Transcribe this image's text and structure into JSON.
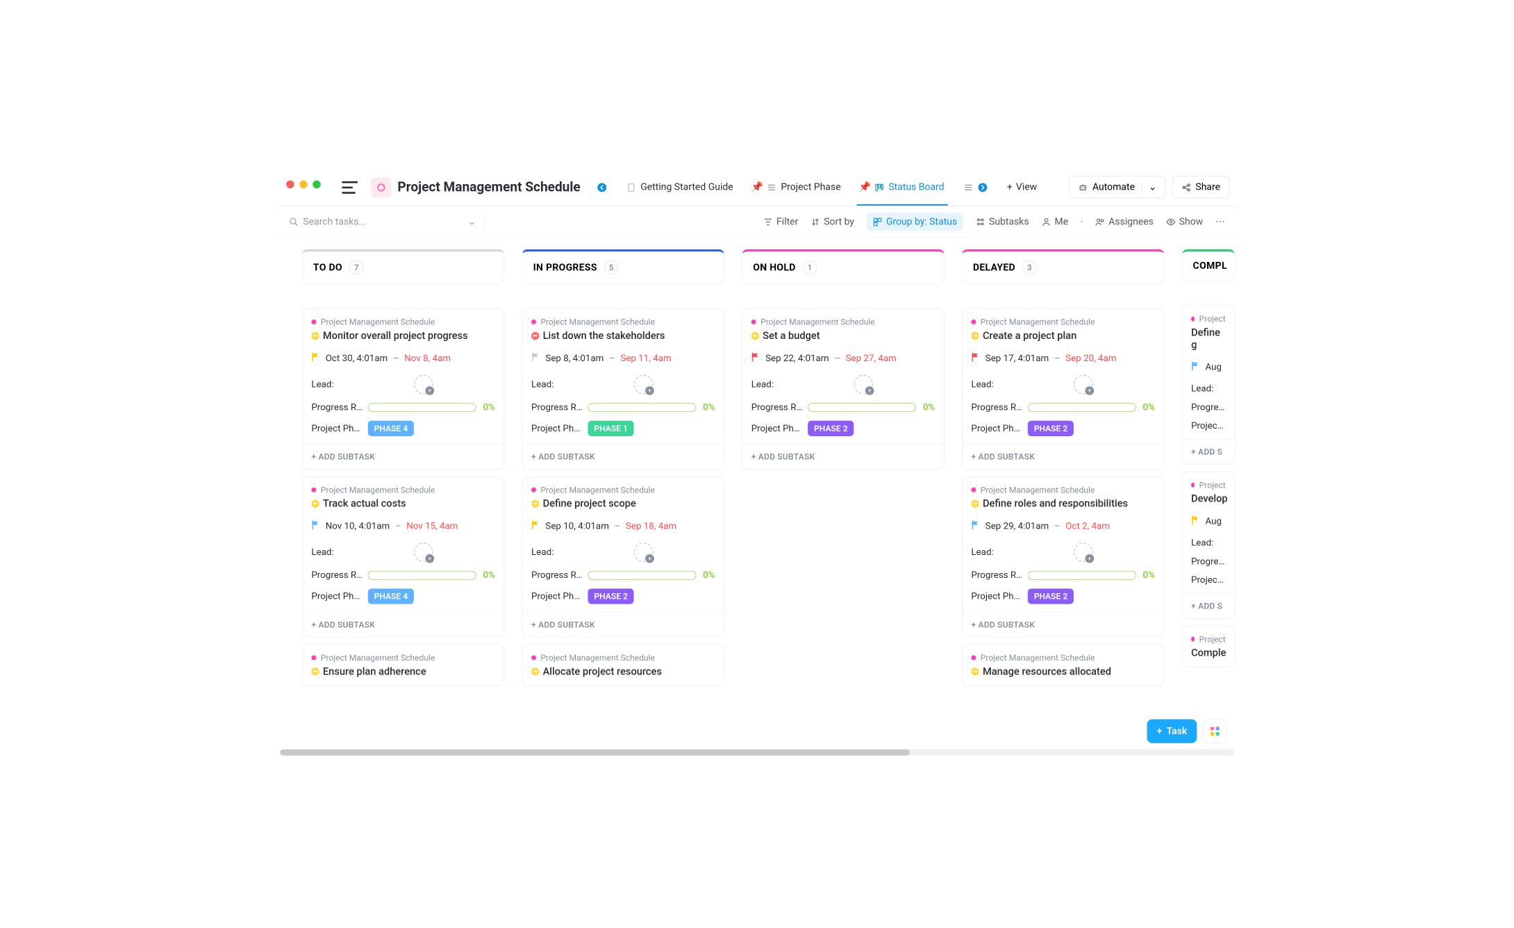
{
  "window": {
    "title": "Project Management Schedule"
  },
  "tabs": {
    "guide": "Getting Started Guide",
    "phase": "Project Phase",
    "status": "Status Board",
    "addView": "View"
  },
  "topButtons": {
    "automate": "Automate",
    "share": "Share"
  },
  "toolbar": {
    "searchPlaceholder": "Search tasks...",
    "filter": "Filter",
    "sortBy": "Sort by",
    "groupBy": "Group by: Status",
    "subtasks": "Subtasks",
    "me": "Me",
    "assignees": "Assignees",
    "show": "Show"
  },
  "labels": {
    "lead": "Lead:",
    "progress": "Progress R...",
    "phase": "Project Pha...",
    "addSubtask": "+ ADD SUBTASK",
    "addSubShort": "+ ADD S",
    "breadcrumb": "Project Management Schedule",
    "breadcrumbShort": "Project",
    "zeroPct": "0%"
  },
  "phaseColors": {
    "PHASE 1": "#3dd598",
    "PHASE 2": "#8b5cf6",
    "PHASE 4": "#60b2ff"
  },
  "flagColors": {
    "yellow": "#ffcc00",
    "gray": "#c7ccd1",
    "red": "#ff4d4f",
    "blue": "#5cb8ff"
  },
  "columns": [
    {
      "id": "todo",
      "title": "TO DO",
      "count": "7",
      "color": "#cfd8dc",
      "cards": [
        {
          "status": "yellow",
          "title": "Monitor overall project progress",
          "flag": "yellow",
          "start": "Oct 30, 4:01am",
          "end": "Nov 8, 4am",
          "phase": "PHASE 4"
        },
        {
          "status": "yellow",
          "title": "Track actual costs",
          "flag": "blue",
          "start": "Nov 10, 4:01am",
          "end": "Nov 15, 4am",
          "phase": "PHASE 4"
        },
        {
          "status": "yellow",
          "title": "Ensure plan adherence",
          "truncated": true
        }
      ]
    },
    {
      "id": "inprogress",
      "title": "IN PROGRESS",
      "count": "5",
      "color": "#2962ff",
      "cards": [
        {
          "status": "red",
          "title": "List down the stakeholders",
          "flag": "gray",
          "start": "Sep 8, 4:01am",
          "end": "Sep 11, 4am",
          "phase": "PHASE 1"
        },
        {
          "status": "yellow",
          "title": "Define project scope",
          "flag": "yellow",
          "start": "Sep 10, 4:01am",
          "end": "Sep 18, 4am",
          "phase": "PHASE 2"
        },
        {
          "status": "yellow",
          "title": "Allocate project resources",
          "truncated": true
        }
      ]
    },
    {
      "id": "onhold",
      "title": "ON HOLD",
      "count": "1",
      "color": "#ff3db5",
      "cards": [
        {
          "status": "yellow",
          "title": "Set a budget",
          "flag": "red",
          "start": "Sep 22, 4:01am",
          "end": "Sep 27, 4am",
          "phase": "PHASE 2"
        }
      ]
    },
    {
      "id": "delayed",
      "title": "DELAYED",
      "count": "3",
      "color": "#ff3db5",
      "cards": [
        {
          "status": "yellow",
          "title": "Create a project plan",
          "flag": "red",
          "start": "Sep 17, 4:01am",
          "end": "Sep 20, 4am",
          "phase": "PHASE 2"
        },
        {
          "status": "yellow",
          "title": "Define roles and responsibilities",
          "flag": "blue",
          "start": "Sep 29, 4:01am",
          "end": "Oct 2, 4am",
          "phase": "PHASE 2"
        },
        {
          "status": "yellow",
          "title": "Manage resources allocated",
          "truncated": true
        }
      ]
    },
    {
      "id": "completed",
      "title": "COMPL",
      "count": "",
      "color": "#2ecc71",
      "partial": true,
      "cards": [
        {
          "status": "none",
          "title": "Define g",
          "flag": "blue",
          "start": "Aug",
          "partial": true
        },
        {
          "status": "none",
          "title": "Develop",
          "flag": "yellow",
          "start": "Aug",
          "partial": true
        },
        {
          "status": "none",
          "title": "Comple",
          "truncated": true,
          "partial": true
        }
      ]
    }
  ],
  "fab": {
    "task": "Task"
  }
}
